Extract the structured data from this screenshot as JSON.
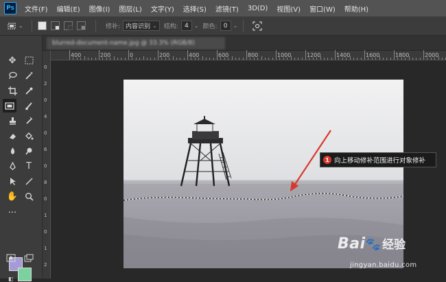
{
  "app": {
    "logo": "Ps"
  },
  "menu": [
    "文件(F)",
    "编辑(E)",
    "图像(I)",
    "图层(L)",
    "文字(Y)",
    "选择(S)",
    "滤镜(T)",
    "3D(D)",
    "视图(V)",
    "窗口(W)",
    "帮助(H)"
  ],
  "options": {
    "patch_label": "修补:",
    "patch_value": "内容识别",
    "structure_label": "结构:",
    "structure_value": "4",
    "color_label": "颜色:",
    "color_value": "0"
  },
  "document_tab": {
    "title": "blurred-document-name.jpg @ 33.3% (RGB/8)"
  },
  "ruler": {
    "labels": [
      "400",
      "200",
      "0",
      "200",
      "400",
      "600",
      "800",
      "1000",
      "1200",
      "1400",
      "1600",
      "1800",
      "2000"
    ],
    "vertical_labels": [
      "0",
      "2",
      "0",
      "4",
      "0",
      "6",
      "0",
      "8",
      "0",
      "1",
      "0",
      "1",
      "2"
    ]
  },
  "colors": {
    "foreground": "#a59cd7",
    "background": "#7bd29e",
    "annotation_marker": "#d9372b",
    "arrow": "#d9372b"
  },
  "annotation": {
    "number": "1",
    "text": "向上移动修补范围进行对象修补"
  },
  "watermark": {
    "brand": "Bai",
    "brand_cn": "经验",
    "url": "jingyan.baidu.com"
  }
}
